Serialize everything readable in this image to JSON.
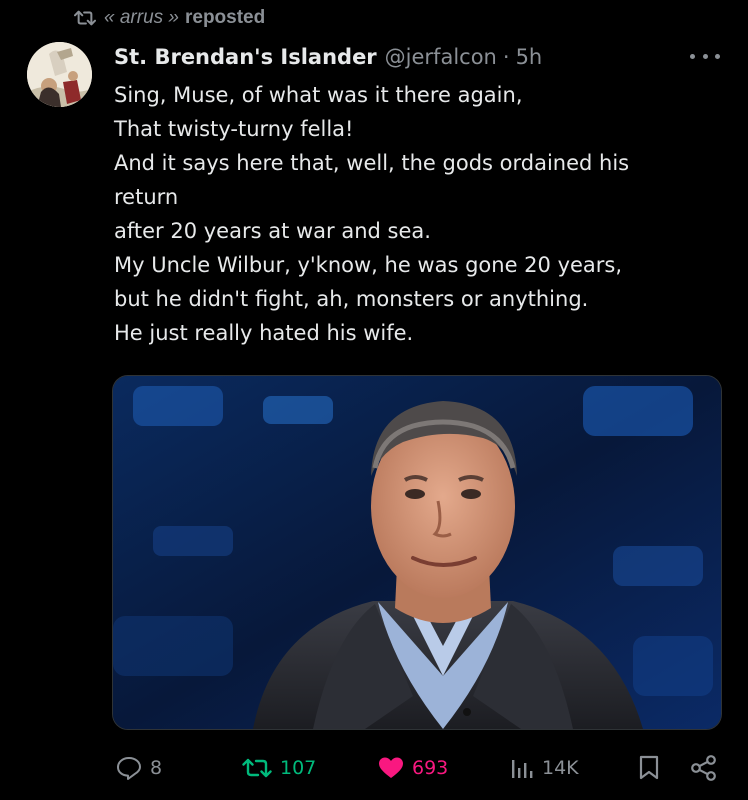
{
  "repost": {
    "icon": "repost-icon",
    "name": "« arrus »",
    "verb": "reposted"
  },
  "post": {
    "avatar_icon": "avatar-painting",
    "display_name": "St. Brendan's Islander",
    "handle": "@jerfalcon",
    "separator": "·",
    "time": "5h",
    "more_icon": "more-icon",
    "lines": [
      "Sing, Muse, of what was it there again,",
      "That twisty-turny fella!",
      "And it says here that, well, the gods ordained his",
      "return",
      "after 20 years at war and sea.",
      "My Uncle Wilbur, y'know, he was gone 20 years,",
      "but he didn't fight, ah, monsters or anything.",
      "He just really hated his wife."
    ],
    "media": {
      "kind": "photo",
      "subject": "photo-man-in-suit"
    }
  },
  "actions": {
    "reply": {
      "icon": "reply-icon",
      "count": "8"
    },
    "retweet": {
      "icon": "retweet-icon",
      "count": "107"
    },
    "like": {
      "icon": "heart-icon",
      "count": "693"
    },
    "views": {
      "icon": "views-icon",
      "count": "14K"
    },
    "bookmark": {
      "icon": "bookmark-icon"
    },
    "share": {
      "icon": "share-icon"
    }
  },
  "colors": {
    "background": "#000000",
    "text": "#e7e9ea",
    "muted": "#8b9096",
    "retweet": "#00ba7c",
    "like": "#f91880"
  }
}
